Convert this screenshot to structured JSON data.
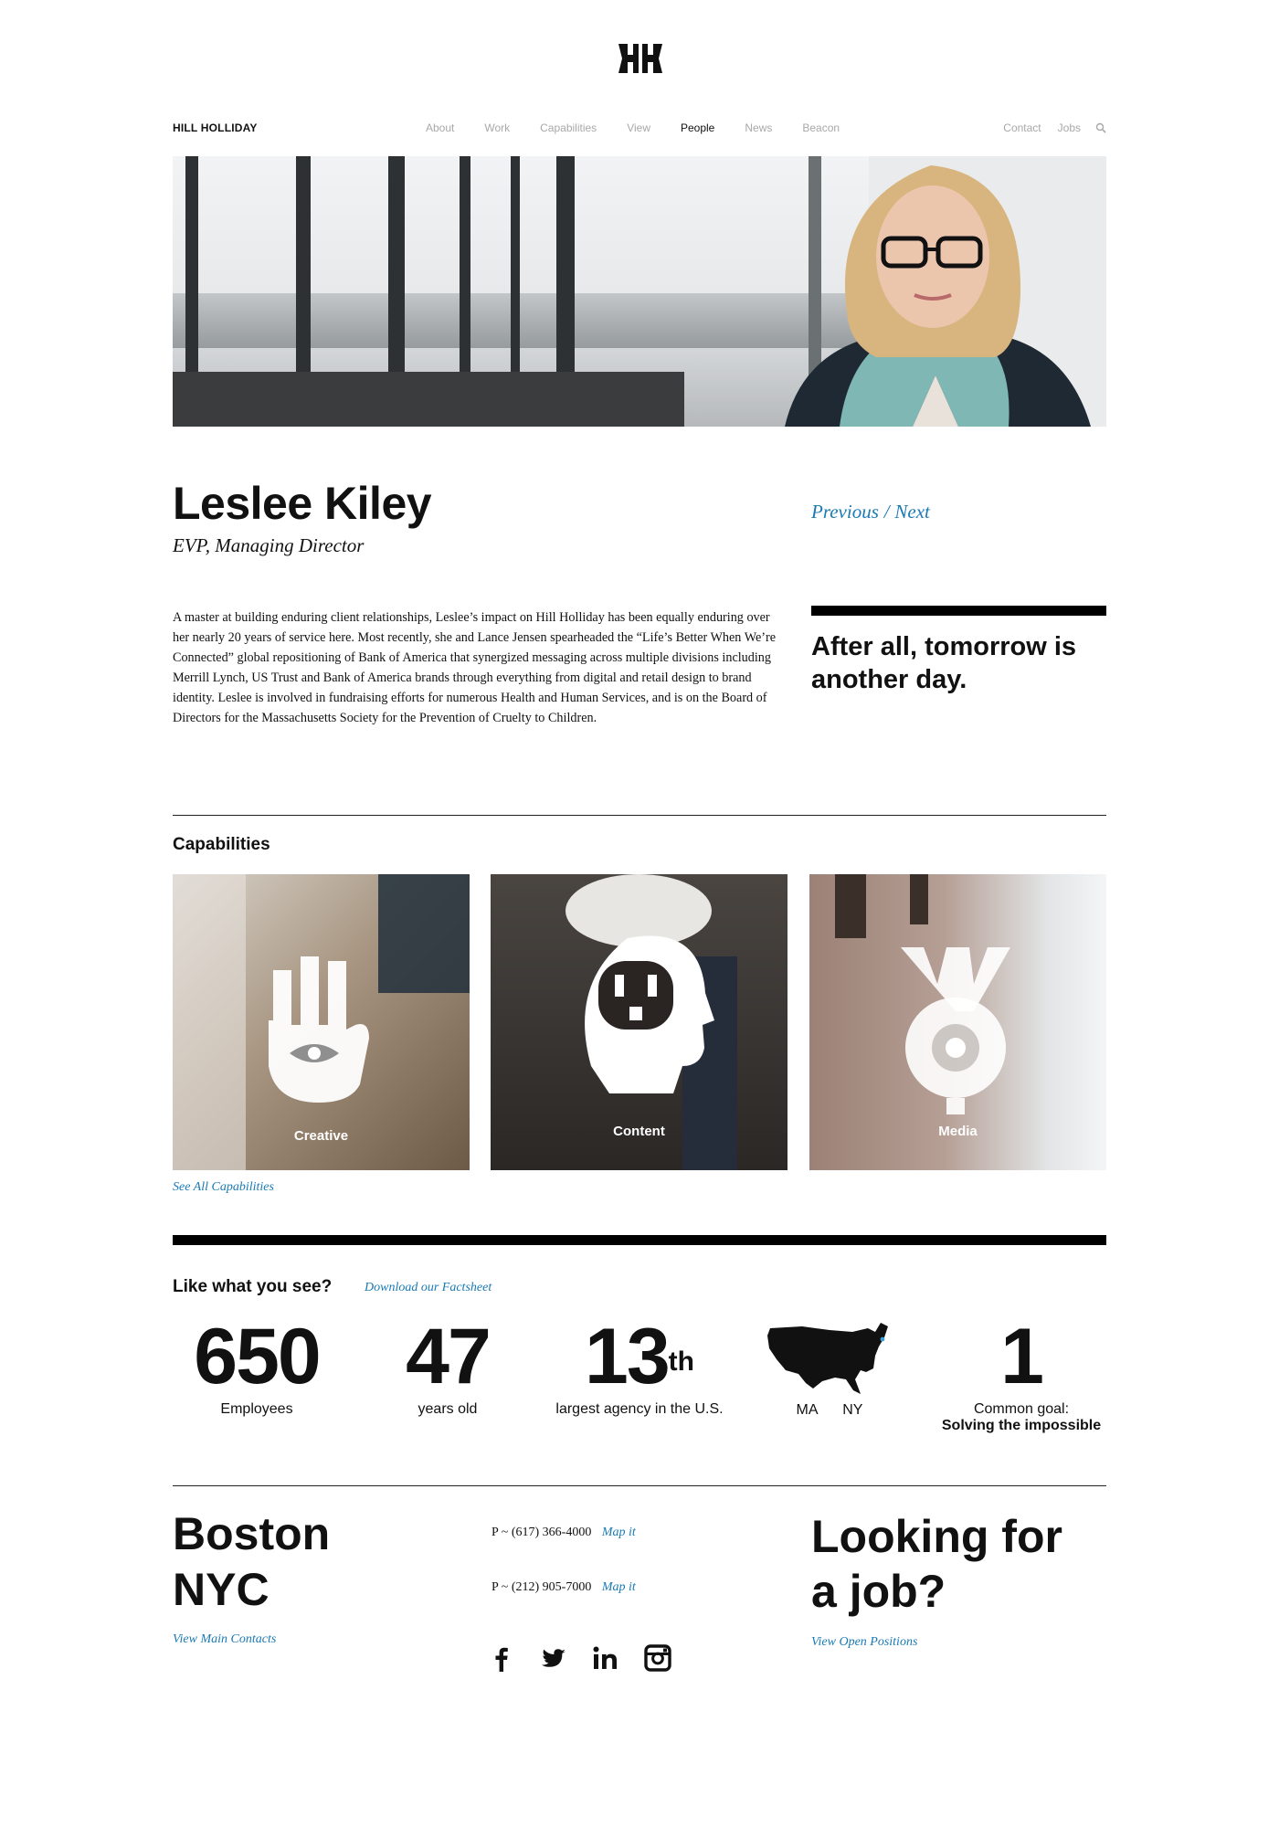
{
  "header": {
    "brand": "HILL HOLLIDAY",
    "nav_center": [
      "About",
      "Work",
      "Capabilities",
      "View",
      "People",
      "News",
      "Beacon"
    ],
    "active_nav": "People",
    "nav_right": [
      "Contact",
      "Jobs"
    ]
  },
  "profile": {
    "name": "Leslee Kiley",
    "title": "EVP, Managing Director",
    "previous": "Previous",
    "separator": "/",
    "next": "Next",
    "bio": "A master at building enduring client relationships, Leslee’s impact on Hill Holliday has been equally enduring over her nearly 20 years of service here. Most recently, she and Lance Jensen spearheaded the “Life’s Better When We’re Connected” global repositioning of Bank of America that synergized messaging across multiple divisions including Merrill Lynch, US Trust and Bank of America brands through everything from digital and retail design to brand identity. Leslee is involved in fundraising efforts for numerous Health and Human Services, and is on the Board of Directors for the Massachusetts Society for the Prevention of Cruelty to Children.",
    "quote": "After all, tomorrow is another day."
  },
  "capabilities": {
    "heading": "Capabilities",
    "tiles": [
      {
        "label": "Creative"
      },
      {
        "label": "Content"
      },
      {
        "label": "Media"
      }
    ],
    "see_all": "See All Capabilities"
  },
  "stats": {
    "heading": "Like what you see?",
    "factsheet": "Download our Factsheet",
    "employees_num": "650",
    "employees_lbl": "Employees",
    "age_num": "47",
    "age_lbl": "years old",
    "rank_num": "13",
    "rank_sup": "th",
    "rank_lbl": "largest agency in the U.S.",
    "loc_ma": "MA",
    "loc_ny": "NY",
    "goal_num": "1",
    "goal_lbl": "Common goal:",
    "goal_lbl2": "Solving the impossible"
  },
  "footer": {
    "city1": "Boston",
    "city2": "NYC",
    "view_contacts": "View Main Contacts",
    "phone1": "P ~ (617) 366-4000",
    "phone2": "P ~ (212) 905-7000",
    "map1": "Map it",
    "map2": "Map it",
    "job_heading_1": "Looking for",
    "job_heading_2": "a job?",
    "view_positions": "View Open Positions"
  }
}
